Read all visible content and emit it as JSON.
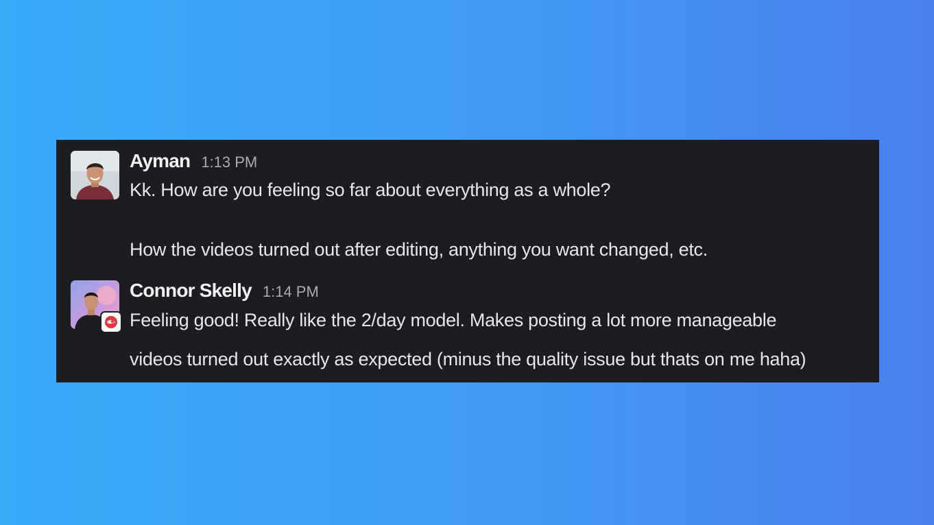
{
  "messages": [
    {
      "author": "Ayman",
      "time": "1:13 PM",
      "avatar_icon": "user-avatar-photo",
      "lines": [
        "Kk. How are you feeling so far about everything as a whole?",
        "How the videos turned out after editing, anything you want changed, etc."
      ]
    },
    {
      "author": "Connor Skelly",
      "time": "1:14 PM",
      "avatar_icon": "user-avatar-photo",
      "badge_icon": "red-emoji-badge-icon",
      "lines": [
        "Feeling good! Really like the 2/day model. Makes posting a lot more manageable",
        "videos turned out exactly as expected (minus the quality issue but thats on me haha)"
      ]
    }
  ],
  "colors": {
    "panel_background": "#1b1d21",
    "author_text": "#f2f2f2",
    "timestamp_text": "#a9abaf",
    "message_text": "#e6e7e9",
    "badge_red": "#e0383e"
  }
}
